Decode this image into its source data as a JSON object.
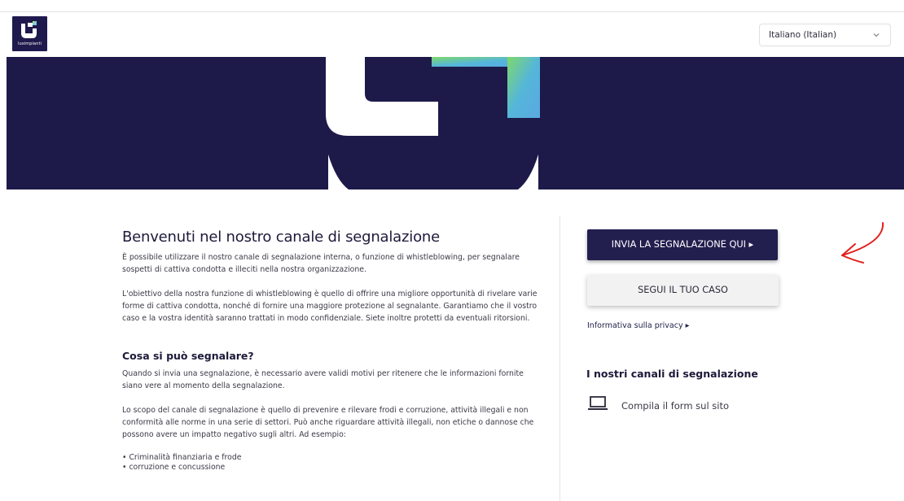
{
  "header": {
    "logo_text": "luximpianti",
    "language": "Italiano (Italian)"
  },
  "main": {
    "title": "Benvenuti nel nostro canale di segnalazione",
    "intro": "È possibile utilizzare il nostro canale di segnalazione interna, o funzione di whistleblowing, per segnalare sospetti di cattiva condotta e illeciti nella nostra organizzazione.",
    "purpose": "L'obiettivo della nostra funzione di whistleblowing è quello di offrire una migliore opportunità di rivelare varie forme di cattiva condotta, nonché di fornire una maggiore protezione al segnalante. Garantiamo che il vostro caso e la vostra identità saranno trattati in modo confidenziale. Siete inoltre protetti da eventuali ritorsioni.",
    "what_title": "Cosa si può segnalare?",
    "what_intro": "Quando si invia una segnalazione, è necessario avere validi motivi per ritenere che le informazioni fornite siano vere al momento della segnalazione.",
    "scope": "Lo scopo del canale di segnalazione è quello di prevenire e rilevare frodi e corruzione, attività illegali e non conformità alle norme in una serie di settori. Può anche riguardare attività illegali, non etiche o dannose che possono avere un impatto negativo sugli altri. Ad esempio:",
    "list": [
      "• Criminalità finanziaria e frode",
      "• corruzione e concussione"
    ]
  },
  "sidebar": {
    "submit_label": "INVIA LA SEGNALAZIONE QUI ▸",
    "follow_label": "SEGUI IL TUO CASO",
    "privacy_label": "Informativa sulla privacy ▸",
    "channels_title": "I nostri canali di segnalazione",
    "channel_label": "Compila il form sul sito",
    "channel_icon": "laptop-icon"
  },
  "colors": {
    "navy": "#1d1a4a",
    "annotation": "#e0201c"
  }
}
